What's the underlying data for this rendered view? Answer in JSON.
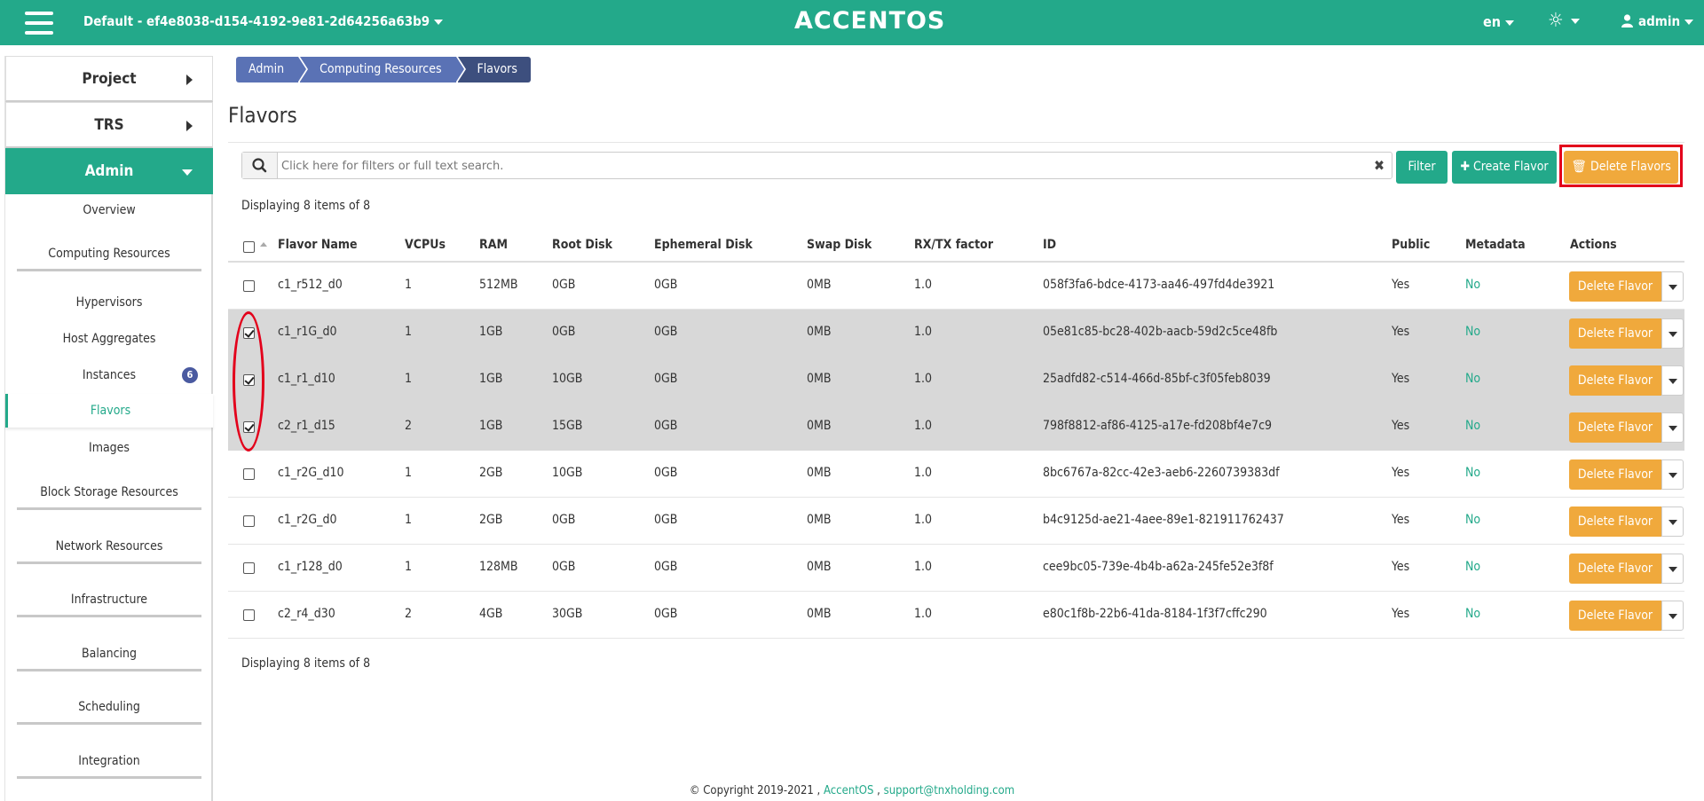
{
  "topbar": {
    "project": "Default - ef4e8038-d154-4192-9e81-2d64256a63b9",
    "logo": "ACCENTOS",
    "lang": "en",
    "user": "admin"
  },
  "sidebar": {
    "main": [
      {
        "label": "Project"
      },
      {
        "label": "TRS"
      },
      {
        "label": "Admin"
      }
    ],
    "items": [
      {
        "label": "Overview"
      },
      {
        "label": "Computing Resources"
      },
      {
        "label": "Hypervisors"
      },
      {
        "label": "Host Aggregates"
      },
      {
        "label": "Instances",
        "badge": "6"
      },
      {
        "label": "Flavors"
      },
      {
        "label": "Images"
      },
      {
        "label": "Block Storage Resources"
      },
      {
        "label": "Network Resources"
      },
      {
        "label": "Infrastructure"
      },
      {
        "label": "Balancing"
      },
      {
        "label": "Scheduling"
      },
      {
        "label": "Integration"
      }
    ]
  },
  "breadcrumb": [
    "Admin",
    "Computing Resources",
    "Flavors"
  ],
  "page_title": "Flavors",
  "search": {
    "placeholder": "Click here for filters or full text search."
  },
  "buttons": {
    "filter": "Filter",
    "create": "Create Flavor",
    "delete_all": "Delete Flavors"
  },
  "display_count": "Displaying 8 items of 8",
  "table": {
    "headers": [
      "Flavor Name",
      "VCPUs",
      "RAM",
      "Root Disk",
      "Ephemeral Disk",
      "Swap Disk",
      "RX/TX factor",
      "ID",
      "Public",
      "Metadata",
      "Actions"
    ],
    "row_action": "Delete Flavor",
    "rows": [
      {
        "name": "c1_r512_d0",
        "vcpus": "1",
        "ram": "512MB",
        "root": "0GB",
        "eph": "0GB",
        "swap": "0MB",
        "rxtx": "1.0",
        "id": "058f3fa6-bdce-4173-aa46-497fd4de3921",
        "public": "Yes",
        "meta": "No",
        "selected": false
      },
      {
        "name": "c1_r1G_d0",
        "vcpus": "1",
        "ram": "1GB",
        "root": "0GB",
        "eph": "0GB",
        "swap": "0MB",
        "rxtx": "1.0",
        "id": "05e81c85-bc28-402b-aacb-59d2c5ce48fb",
        "public": "Yes",
        "meta": "No",
        "selected": true
      },
      {
        "name": "c1_r1_d10",
        "vcpus": "1",
        "ram": "1GB",
        "root": "10GB",
        "eph": "0GB",
        "swap": "0MB",
        "rxtx": "1.0",
        "id": "25adfd82-c514-466d-85bf-c3f05feb8039",
        "public": "Yes",
        "meta": "No",
        "selected": true
      },
      {
        "name": "c2_r1_d15",
        "vcpus": "2",
        "ram": "1GB",
        "root": "15GB",
        "eph": "0GB",
        "swap": "0MB",
        "rxtx": "1.0",
        "id": "798f8812-af86-4125-a17e-fd208bf4e7c9",
        "public": "Yes",
        "meta": "No",
        "selected": true
      },
      {
        "name": "c1_r2G_d10",
        "vcpus": "1",
        "ram": "2GB",
        "root": "10GB",
        "eph": "0GB",
        "swap": "0MB",
        "rxtx": "1.0",
        "id": "8bc6767a-82cc-42e3-aeb6-2260739383df",
        "public": "Yes",
        "meta": "No",
        "selected": false
      },
      {
        "name": "c1_r2G_d0",
        "vcpus": "1",
        "ram": "2GB",
        "root": "0GB",
        "eph": "0GB",
        "swap": "0MB",
        "rxtx": "1.0",
        "id": "b4c9125d-ae21-4aee-89e1-821911762437",
        "public": "Yes",
        "meta": "No",
        "selected": false
      },
      {
        "name": "c1_r128_d0",
        "vcpus": "1",
        "ram": "128MB",
        "root": "0GB",
        "eph": "0GB",
        "swap": "0MB",
        "rxtx": "1.0",
        "id": "cee9bc05-739e-4b4b-a62a-245fe52e3f8f",
        "public": "Yes",
        "meta": "No",
        "selected": false
      },
      {
        "name": "c2_r4_d30",
        "vcpus": "2",
        "ram": "4GB",
        "root": "30GB",
        "eph": "0GB",
        "swap": "0MB",
        "rxtx": "1.0",
        "id": "e80c1f8b-22b6-41da-8184-1f3f7cffc290",
        "public": "Yes",
        "meta": "No",
        "selected": false
      }
    ]
  },
  "footer": {
    "copyright": "© Copyright 2019-2021 ,",
    "brand": "AccentOS",
    "sep": ",",
    "email": "support@tnxholding.com"
  },
  "colors": {
    "primary": "#23a98a",
    "warning": "#f0a93c",
    "breadcrumb": "#5a72b5",
    "highlight": "#e3001b"
  }
}
